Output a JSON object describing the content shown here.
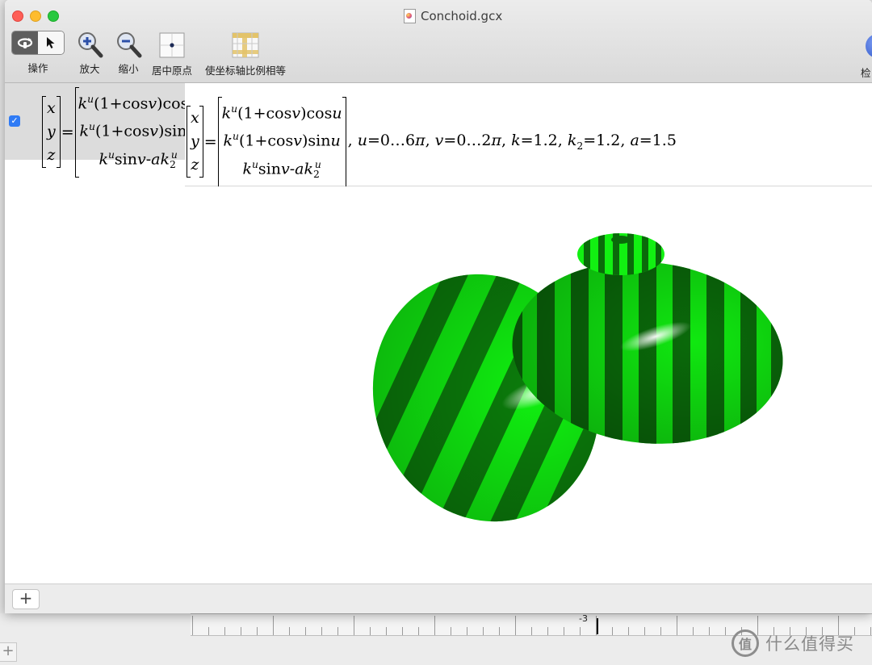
{
  "window": {
    "title": "Conchoid.gcx"
  },
  "toolbar": {
    "operate_label": "操作",
    "zoom_in_label": "放大",
    "zoom_out_label": "缩小",
    "center_origin_label": "居中原点",
    "equal_axes_label": "使坐标轴比例相等",
    "right_label": "检"
  },
  "expression": {
    "vector": [
      "x",
      "y",
      "z"
    ],
    "row1": "k^u(1+cos v)cos u",
    "row2": "k^u(1+cos v)sin u",
    "row3": "k^u sin v - a k_2^u",
    "params": ", u=0…6π, v=0…2π, k=1.2, k₂=1.2, a=1.5",
    "enabled": true
  },
  "ruler": {
    "label": "-3"
  },
  "watermark": {
    "text": "什么值得买",
    "logo": "值"
  },
  "colors": {
    "surface_light": "#11ee11",
    "surface_dark": "#0a6e0a",
    "accent": "#2f7bf5"
  }
}
